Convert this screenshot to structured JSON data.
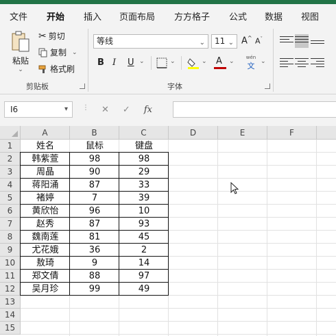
{
  "ribbon_tabs": [
    {
      "label": "文件"
    },
    {
      "label": "开始"
    },
    {
      "label": "插入"
    },
    {
      "label": "页面布局"
    },
    {
      "label": "方方格子"
    },
    {
      "label": "公式"
    },
    {
      "label": "数据"
    },
    {
      "label": "视图"
    }
  ],
  "active_tab": "开始",
  "clipboard": {
    "paste_label": "粘贴",
    "cut_label": "剪切",
    "copy_label": "复制",
    "format_painter_label": "格式刷",
    "group_label": "剪贴板"
  },
  "font": {
    "font_name": "等线",
    "font_size": "11",
    "group_label": "字体",
    "bold": "B",
    "italic": "I",
    "underline": "U",
    "wen_top": "wén",
    "wen_bottom": "文",
    "font_color": "#c00000",
    "fill_color": "#ffff00"
  },
  "formula_bar": {
    "name_box": "I6",
    "fx_label": "fx",
    "formula": ""
  },
  "columns": [
    "A",
    "B",
    "C",
    "D",
    "E",
    "F"
  ],
  "rows": [
    "1",
    "2",
    "3",
    "4",
    "5",
    "6",
    "7",
    "8",
    "9",
    "10",
    "11",
    "12",
    "13",
    "14",
    "15"
  ],
  "table": {
    "headers": [
      "姓名",
      "鼠标",
      "键盘"
    ],
    "rows": [
      [
        "韩紫萱",
        "98",
        "98"
      ],
      [
        "周晶",
        "90",
        "29"
      ],
      [
        "蒋阳涌",
        "87",
        "33"
      ],
      [
        "褚婷",
        "7",
        "39"
      ],
      [
        "黄欣怡",
        "96",
        "10"
      ],
      [
        "赵秀",
        "87",
        "93"
      ],
      [
        "魏南莲",
        "81",
        "45"
      ],
      [
        "尤花娥",
        "36",
        "2"
      ],
      [
        "敖琦",
        "9",
        "14"
      ],
      [
        "郑文倩",
        "88",
        "97"
      ],
      [
        "吴月珍",
        "99",
        "49"
      ]
    ]
  },
  "accent_color": "#217346"
}
